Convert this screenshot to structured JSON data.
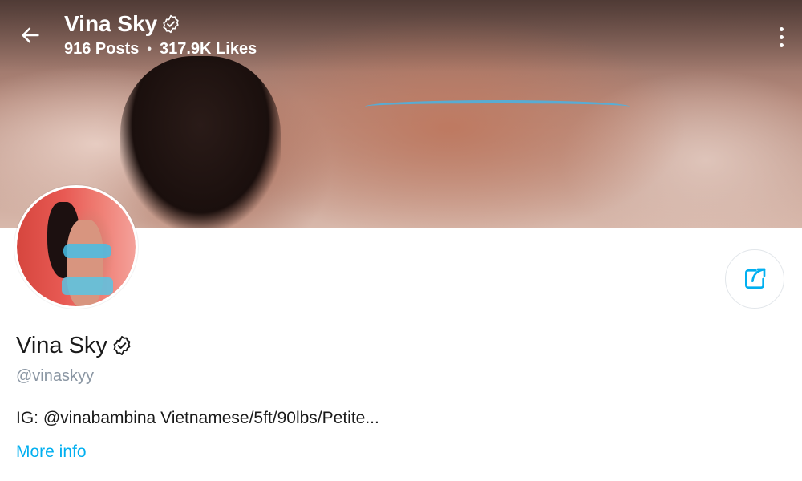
{
  "header": {
    "name": "Vina Sky",
    "posts": "916 Posts",
    "separator": "•",
    "likes": "317.9K Likes"
  },
  "profile": {
    "name": "Vina Sky",
    "handle": "@vinaskyy",
    "bio": "IG: @vinabambina Vietnamese/5ft/90lbs/Petite...",
    "more_info": "More info"
  },
  "icons": {
    "back": "arrow-left-icon",
    "verified": "verified-badge-icon",
    "more": "more-vertical-icon",
    "share": "share-icon"
  },
  "colors": {
    "accent": "#00aff0",
    "text_primary": "#1a1a1a",
    "text_secondary": "#8a96a3"
  }
}
